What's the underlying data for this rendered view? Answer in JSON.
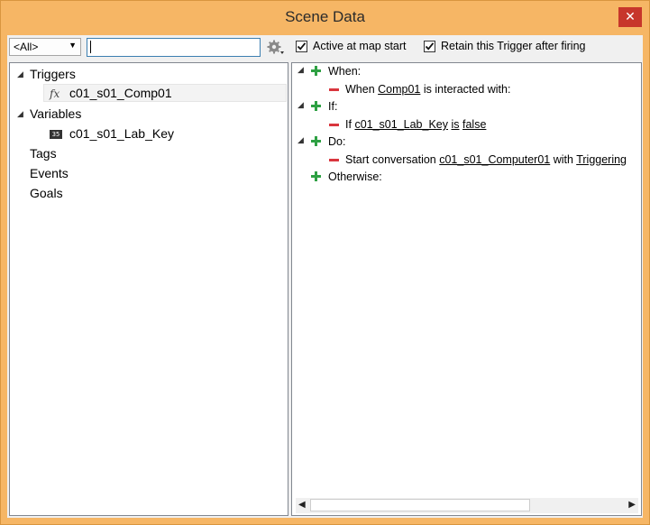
{
  "window": {
    "title": "Scene Data"
  },
  "toolbar": {
    "filter_value": "<All>",
    "search_value": "",
    "active_at_start_label": "Active at map start",
    "active_at_start_checked": true,
    "retain_label": "Retain this Trigger after firing",
    "retain_checked": true
  },
  "tree": {
    "triggers_label": "Triggers",
    "trigger_item": "c01_s01_Comp01",
    "variables_label": "Variables",
    "variable_item": "c01_s01_Lab_Key",
    "tags_label": "Tags",
    "events_label": "Events",
    "goals_label": "Goals"
  },
  "trigger_editor": {
    "when_label": "When:",
    "when_prefix": "When",
    "when_target": "Comp01",
    "when_suffix": "is interacted with:",
    "if_label": "If:",
    "if_prefix": "If",
    "if_var": "c01_s01_Lab_Key",
    "if_is": "is",
    "if_value": "false",
    "do_label": "Do:",
    "do_prefix": "Start conversation",
    "do_conv": "c01_s01_Computer01",
    "do_with": "with",
    "do_target": "Triggering",
    "otherwise_label": "Otherwise:"
  },
  "colors": {
    "title_bar": "#f6b665",
    "close": "#c7362b",
    "add": "#2ea043",
    "remove": "#d9363e"
  }
}
